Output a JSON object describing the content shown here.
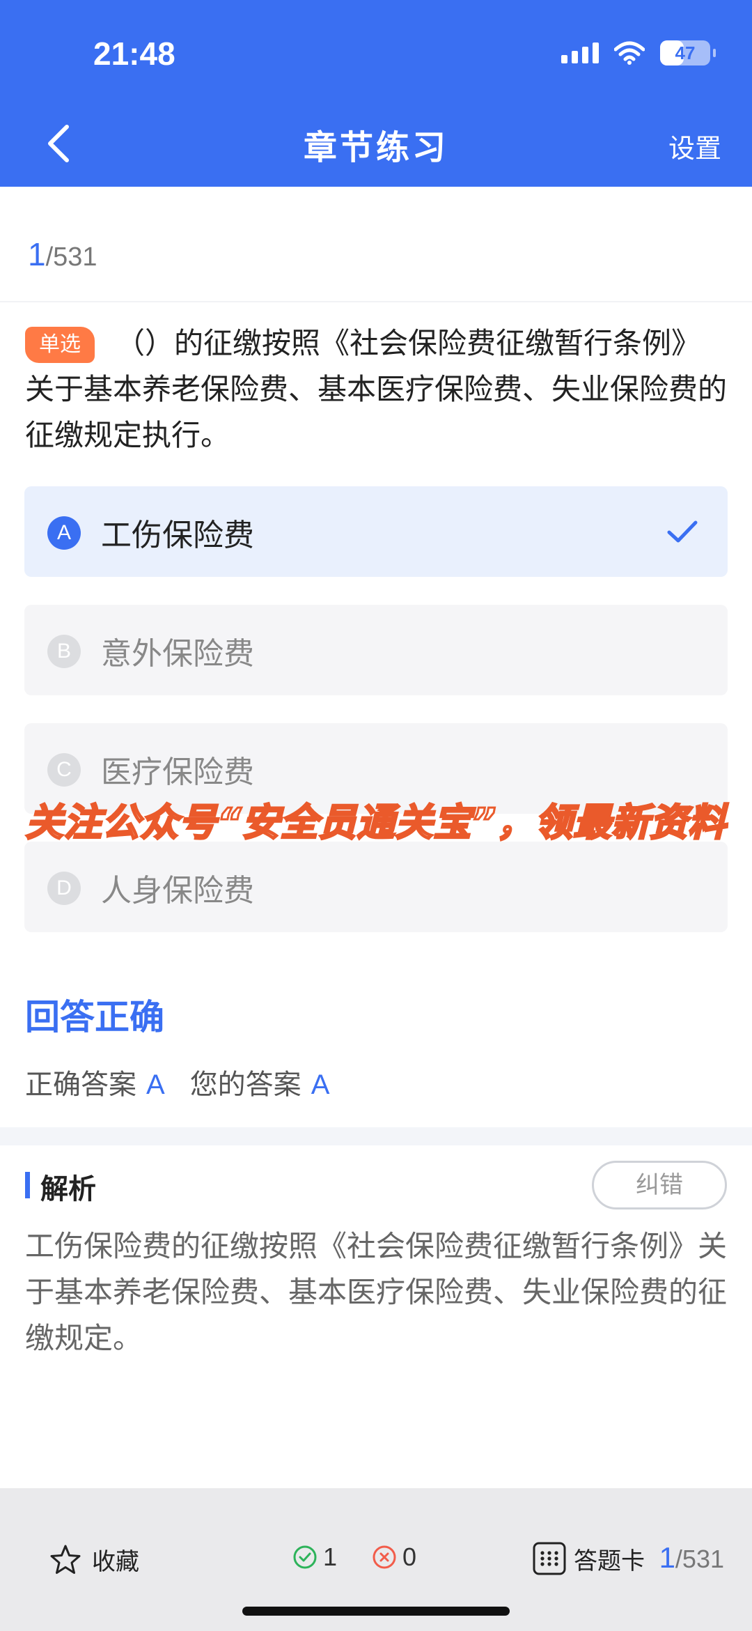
{
  "status": {
    "time": "21:48",
    "battery": "47",
    "battery_level": 0.47
  },
  "header": {
    "title": "章节练习",
    "settings": "设置"
  },
  "progress": {
    "current": "1",
    "total": "/531"
  },
  "question": {
    "type_badge": "单选",
    "text": "（）的征缴按照《社会保险费征缴暂行条例》关于基本养老保险费、基本医疗保险费、失业保险费的征缴规定执行。"
  },
  "options": [
    {
      "letter": "A",
      "text": "工伤保险费"
    },
    {
      "letter": "B",
      "text": "意外保险费"
    },
    {
      "letter": "C",
      "text": "医疗保险费"
    },
    {
      "letter": "D",
      "text": "人身保险费"
    }
  ],
  "watermark": "关注公众号“安全员通关宝”，领最新资料",
  "result": {
    "title": "回答正确",
    "correct_label": "正确答案",
    "correct_value": "A",
    "your_label": "您的答案",
    "your_value": "A"
  },
  "analysis": {
    "title": "解析",
    "report_button": "纠错",
    "text": "工伤保险费的征缴按照《社会保险费征缴暂行条例》关于基本养老保险费、基本医疗保险费、失业保险费的征缴规定。"
  },
  "bottom": {
    "favorite": "收藏",
    "correct_count": "1",
    "wrong_count": "0",
    "answer_card": "答题卡",
    "current": "1",
    "total": "/531"
  },
  "colors": {
    "primary": "#3a6ff2",
    "badge": "#ff7a45",
    "watermark_stroke": "#ea5a2b",
    "correct": "#2db35a",
    "wrong": "#f25c4a"
  },
  "icons": [
    "back-icon",
    "check-icon",
    "star-icon",
    "check-circle-icon",
    "cross-circle-icon",
    "grid-icon",
    "wifi-icon",
    "signal-icon",
    "battery-icon"
  ]
}
